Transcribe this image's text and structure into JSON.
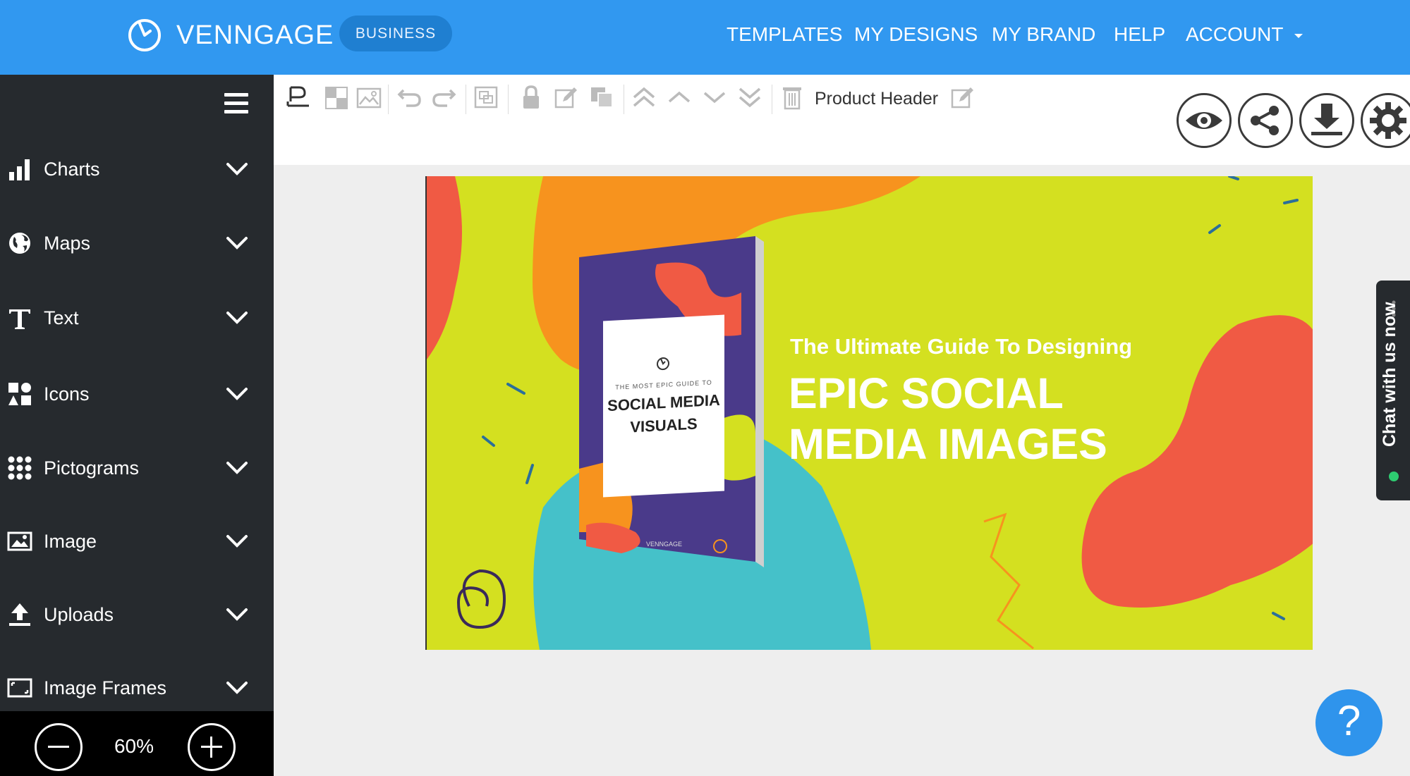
{
  "header": {
    "logo_text": "VENNGAGE",
    "plan_badge": "BUSINESS",
    "nav": [
      "TEMPLATES",
      "MY DESIGNS",
      "MY BRAND",
      "HELP",
      "ACCOUNT"
    ]
  },
  "sidebar": {
    "items": [
      {
        "label": "Charts",
        "icon": "bar-chart-icon"
      },
      {
        "label": "Maps",
        "icon": "globe-icon"
      },
      {
        "label": "Text",
        "icon": "text-icon"
      },
      {
        "label": "Icons",
        "icon": "shapes-icon"
      },
      {
        "label": "Pictograms",
        "icon": "dot-grid-icon"
      },
      {
        "label": "Image",
        "icon": "image-icon"
      },
      {
        "label": "Uploads",
        "icon": "upload-icon"
      },
      {
        "label": "Image Frames",
        "icon": "frame-icon"
      }
    ],
    "zoom": "60%"
  },
  "toolbar": {
    "selected_label": "Product Header"
  },
  "canvas": {
    "book": {
      "small_title": "THE MOST EPIC GUIDE TO",
      "title_line1": "SOCIAL MEDIA",
      "title_line2": "VISUALS",
      "brand": "VENNGAGE"
    },
    "headline_small": "The Ultimate Guide To Designing",
    "headline_big_line1": "EPIC SOCIAL",
    "headline_big_line2": "MEDIA IMAGES"
  },
  "chat": {
    "label": "Chat with us now"
  },
  "help": {
    "label": "?"
  },
  "colors": {
    "topbar": "#3198f0",
    "sidebar": "#262a2e",
    "canvas_bg": "#d4e020",
    "orange": "#f7931e",
    "red": "#f05a44",
    "teal": "#45c1c9",
    "purple": "#4a3a8a"
  }
}
